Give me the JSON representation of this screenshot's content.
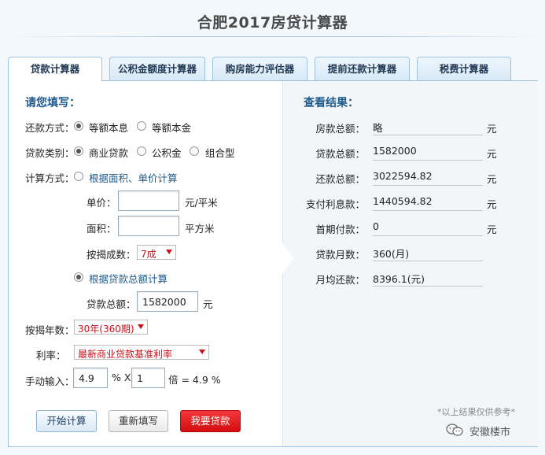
{
  "title": "合肥2017房贷计算器",
  "tabs": [
    {
      "label": "贷款计算器",
      "active": true
    },
    {
      "label": "公积金额度计算器",
      "active": false
    },
    {
      "label": "购房能力评估器",
      "active": false
    },
    {
      "label": "提前还款计算器",
      "active": false
    },
    {
      "label": "税费计算器",
      "active": false
    }
  ],
  "form": {
    "heading": "请您填写：",
    "repay_method": {
      "label": "还款方式：",
      "options": [
        "等额本息",
        "等额本金"
      ],
      "selected": "等额本息"
    },
    "loan_type": {
      "label": "贷款类别：",
      "options": [
        "商业贷款",
        "公积金",
        "组合型"
      ],
      "selected": "商业贷款"
    },
    "calc_method": {
      "label": "计算方式：",
      "option_area": "根据面积、单价计算",
      "option_total": "根据贷款总额计算",
      "selected": "根据贷款总额计算"
    },
    "unit_price": {
      "label": "单价：",
      "value": "",
      "unit": "元/平米"
    },
    "area": {
      "label": "面积：",
      "value": "",
      "unit": "平方米"
    },
    "ratio": {
      "label": "按揭成数：",
      "value": "7成"
    },
    "loan_total": {
      "label": "贷款总额：",
      "value": "1582000",
      "unit": "元"
    },
    "years": {
      "label": "按揭年数：",
      "value": "30年(360期)"
    },
    "rate": {
      "label": "利率：",
      "value": "最新商业贷款基准利率"
    },
    "manual": {
      "label": "手动输入：",
      "rate_value": "4.9",
      "percent_x": "% X",
      "multiplier": "1",
      "result": "倍 = 4.9 %"
    }
  },
  "buttons": {
    "calc": "开始计算",
    "reset": "重新填写",
    "loan": "我要贷款"
  },
  "results": {
    "heading": "查看结果：",
    "rows": [
      {
        "label": "房款总额：",
        "value": "略",
        "unit": "元"
      },
      {
        "label": "贷款总额：",
        "value": "1582000",
        "unit": "元"
      },
      {
        "label": "还款总额：",
        "value": "3022594.82",
        "unit": "元"
      },
      {
        "label": "支付利息款：",
        "value": "1440594.82",
        "unit": "元"
      },
      {
        "label": "首期付款：",
        "value": "0",
        "unit": "元"
      },
      {
        "label": "贷款月数：",
        "value": "360(月)",
        "unit": ""
      },
      {
        "label": "月均还款：",
        "value": "8396.1(元)",
        "unit": ""
      }
    ],
    "note": "*以上结果仅供参考*"
  },
  "watermark": {
    "text": "安徽楼市",
    "icon": "wechat-icon"
  },
  "colors": {
    "accent": "#1f5a8c",
    "red": "#c8141e",
    "button_red": "#e02022"
  }
}
